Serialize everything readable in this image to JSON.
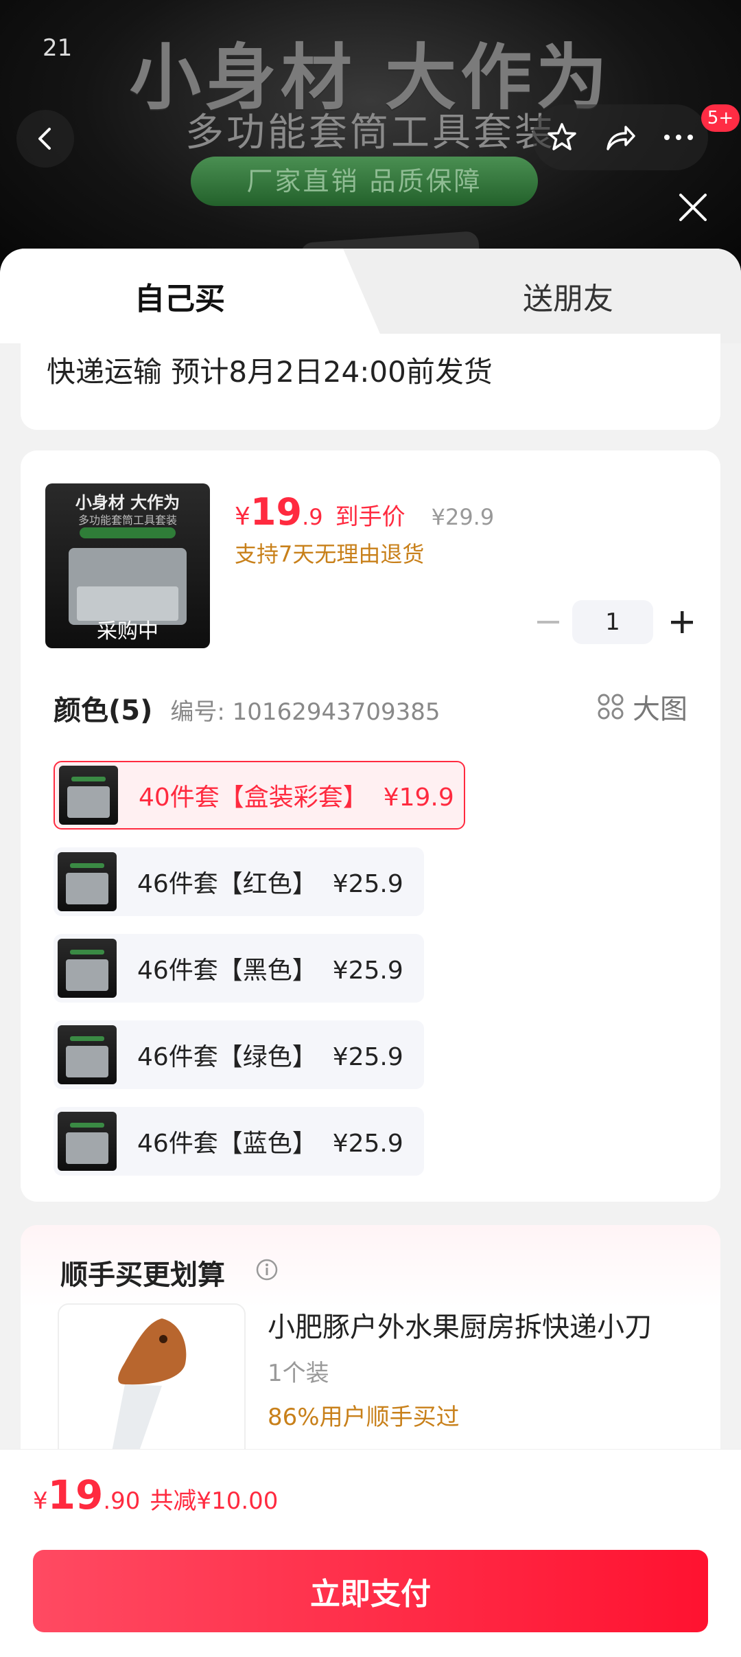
{
  "status_bar": {
    "time": "21",
    "right": ""
  },
  "banner": {
    "title": "小身材 大作为",
    "subtitle": "多功能套筒工具套装",
    "pill": "厂家直销 品质保障",
    "cart_badge": "5+"
  },
  "tabs": {
    "self": "自己买",
    "gift": "送朋友"
  },
  "shipping": {
    "text": "快递运输 预计8月2日24:00前发货"
  },
  "product": {
    "thumb_title": "小身材 大作为",
    "thumb_sub": "多功能套筒工具套装",
    "thumb_status": "采购中",
    "price_currency": "¥",
    "price_int": "19",
    "price_dec": ".9",
    "price_label": "到手价",
    "original_price": "¥29.9",
    "return_policy": "支持7天无理由退货",
    "quantity": "1"
  },
  "variants": {
    "header": "颜色(5)",
    "code": "编号: 10162943709385",
    "big_image_label": "大图",
    "options": [
      {
        "label": "40件套【盒装彩套】  ¥19.9",
        "selected": true
      },
      {
        "label": "46件套【红色】  ¥25.9",
        "selected": false
      },
      {
        "label": "46件套【黑色】  ¥25.9",
        "selected": false
      },
      {
        "label": "46件套【绿色】  ¥25.9",
        "selected": false
      },
      {
        "label": "46件套【蓝色】  ¥25.9",
        "selected": false
      }
    ]
  },
  "addon": {
    "title": "顺手买更划算",
    "name": "小肥豚户外水果厨房拆快递小刀",
    "spec": "1个装",
    "stat": "86%用户顺手买过"
  },
  "footer": {
    "currency": "¥",
    "total_int": "19",
    "total_dec": ".90",
    "saving": "共减¥10.00",
    "pay_label": "立即支付"
  },
  "colors": {
    "accent": "#ff2a3f",
    "orange": "#c8801a",
    "selected_bg": "#fff0f2"
  },
  "icons": [
    "back-icon",
    "star-icon",
    "share-icon",
    "more-icon",
    "close-icon",
    "minus-icon",
    "plus-icon",
    "grid-icon",
    "info-icon"
  ]
}
